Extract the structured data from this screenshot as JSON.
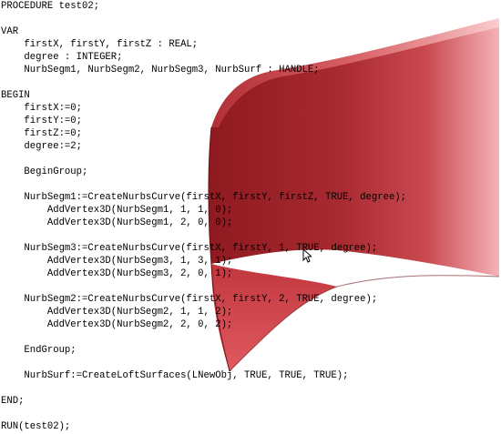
{
  "editor": {
    "lines": [
      "PROCEDURE test02;",
      "",
      "VAR",
      "    firstX, firstY, firstZ : REAL;",
      "    degree : INTEGER;",
      "    NurbSegm1, NurbSegm2, NurbSegm3, NurbSurf : HANDLE;",
      "",
      "BEGIN",
      "    firstX:=0;",
      "    firstY:=0;",
      "    firstZ:=0;",
      "    degree:=2;",
      "",
      "    BeginGroup;",
      "",
      "    NurbSegm1:=CreateNurbsCurve(firstX, firstY, firstZ, TRUE, degree);",
      "        AddVertex3D(NurbSegm1, 1, 1, 0);",
      "        AddVertex3D(NurbSegm1, 2, 0, 0);",
      "",
      "    NurbSegm3:=CreateNurbsCurve(firstX, firstY, 1, TRUE, degree);",
      "        AddVertex3D(NurbSegm3, 1, 3, 1);",
      "        AddVertex3D(NurbSegm3, 2, 0, 1);",
      "",
      "    NurbSegm2:=CreateNurbsCurve(firstX, firstY, 2, TRUE, degree);",
      "        AddVertex3D(NurbSegm2, 1, 1, 2);",
      "        AddVertex3D(NurbSegm2, 2, 0, 2);",
      "",
      "    EndGroup;",
      "",
      "    NurbSurf:=CreateLoftSurfaces(LNewObj, TRUE, TRUE, TRUE);",
      "",
      "END;",
      "",
      "RUN(test02);"
    ]
  },
  "viewport": {
    "surface_colors": {
      "dark": "#8e1a1f",
      "mid": "#c23c43",
      "light": "#f2a8ab",
      "edge": "#6b0f14"
    }
  }
}
